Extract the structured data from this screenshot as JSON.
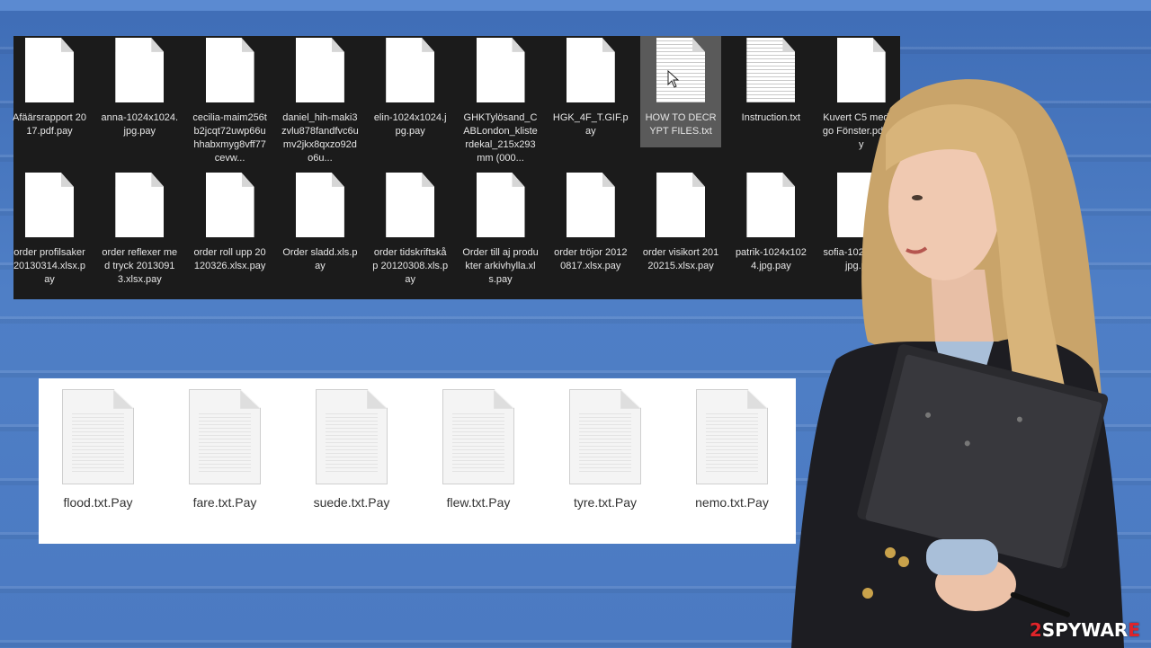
{
  "explorer": {
    "row1": [
      {
        "name": "Afäärsrapport 2017.pdf.pay",
        "icon": "blank-file-icon"
      },
      {
        "name": "anna-1024x1024.jpg.pay",
        "icon": "blank-file-icon"
      },
      {
        "name": "cecilia-maim256tb2jcqt72uwp66uhhabxmyg8vff77cevw...",
        "icon": "blank-file-icon"
      },
      {
        "name": "daniel_hih-maki3zvlu878fandfvc6umv2jkx8qxzo92do6u...",
        "icon": "blank-file-icon"
      },
      {
        "name": "elin-1024x1024.jpg.pay",
        "icon": "blank-file-icon"
      },
      {
        "name": "GHKTylösand_CABLondon_klisterdekal_215x293mm (000...",
        "icon": "blank-file-icon"
      },
      {
        "name": "HGK_4F_T.GIF.pay",
        "icon": "blank-file-icon"
      },
      {
        "name": "HOW TO DECRYPT FILES.txt",
        "icon": "text-file-icon",
        "selected": true
      },
      {
        "name": "Instruction.txt",
        "icon": "text-file-icon"
      },
      {
        "name": "Kuvert C5 med logo Fönster.pdf.pay",
        "icon": "blank-file-icon"
      }
    ],
    "row2": [
      {
        "name": "order profilsaker 20130314.xlsx.pay",
        "icon": "blank-file-icon"
      },
      {
        "name": "order reflexer med tryck 20130913.xlsx.pay",
        "icon": "blank-file-icon"
      },
      {
        "name": "order roll upp 20120326.xlsx.pay",
        "icon": "blank-file-icon"
      },
      {
        "name": "Order sladd.xls.pay",
        "icon": "blank-file-icon"
      },
      {
        "name": "order tidskriftskåp 20120308.xls.pay",
        "icon": "blank-file-icon"
      },
      {
        "name": "Order till aj produkter arkivhylla.xls.pay",
        "icon": "blank-file-icon"
      },
      {
        "name": "order tröjor 20120817.xlsx.pay",
        "icon": "blank-file-icon"
      },
      {
        "name": "order visikort 20120215.xlsx.pay",
        "icon": "blank-file-icon"
      },
      {
        "name": "patrik-1024x1024.jpg.pay",
        "icon": "blank-file-icon"
      },
      {
        "name": "sofia-1024x1024.jpg.pay",
        "icon": "blank-file-icon"
      }
    ]
  },
  "files_panel": {
    "items": [
      {
        "name": "flood.txt.Pay",
        "icon": "text-file-icon"
      },
      {
        "name": "fare.txt.Pay",
        "icon": "text-file-icon"
      },
      {
        "name": "suede.txt.Pay",
        "icon": "text-file-icon"
      },
      {
        "name": "flew.txt.Pay",
        "icon": "text-file-icon"
      },
      {
        "name": "tyre.txt.Pay",
        "icon": "text-file-icon"
      },
      {
        "name": "nemo.txt.Pay",
        "icon": "text-file-icon"
      }
    ]
  },
  "watermark": {
    "prefix": "2",
    "suffix": "SPYWAR",
    "mark": "E"
  },
  "colors": {
    "accent_red": "#e0242a",
    "panel_dark": "#1b1b1b",
    "background_blue": "#4b7ac2"
  }
}
